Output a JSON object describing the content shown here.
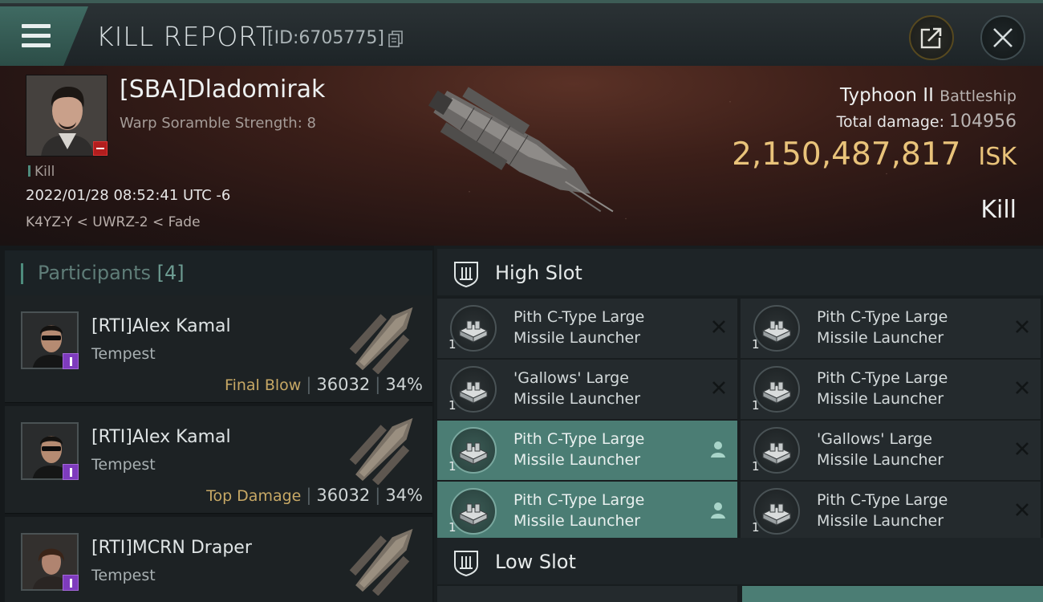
{
  "header": {
    "title": "KILL REPORT",
    "report_id": "[ID:6705775]"
  },
  "victim": {
    "name": "[SBA]Dladomirak",
    "attribute": "Warp Soramble Strength: 8",
    "tag": "Kill",
    "time": "2022/01/28 08:52:41 UTC -6",
    "location": "K4YZ-Y < UWRZ-2 < Fade",
    "ship": "Typhoon II",
    "ship_class": "Battleship",
    "total_damage_label": "Total damage:",
    "total_damage": "104956",
    "isk_value": "2,150,487,817",
    "isk_unit": "ISK",
    "result": "Kill"
  },
  "participants": {
    "title": "Participants",
    "count": "[4]",
    "rows": [
      {
        "name": "[RTI]Alex Kamal",
        "ship": "Tempest",
        "label": "Final Blow",
        "damage": "36032",
        "percent": "34%"
      },
      {
        "name": "[RTI]Alex Kamal",
        "ship": "Tempest",
        "label": "Top Damage",
        "damage": "36032",
        "percent": "34%"
      },
      {
        "name": "[RTI]MCRN Draper",
        "ship": "Tempest",
        "label": "",
        "damage": "",
        "percent": ""
      }
    ]
  },
  "high_slot": {
    "label": "High Slot",
    "modules": [
      {
        "line1": "Pith C-Type Large",
        "line2": "Missile Launcher",
        "qty": "1",
        "state": "destroyed"
      },
      {
        "line1": "Pith C-Type Large",
        "line2": "Missile Launcher",
        "qty": "1",
        "state": "destroyed"
      },
      {
        "line1": "'Gallows' Large",
        "line2": "Missile Launcher",
        "qty": "1",
        "state": "destroyed"
      },
      {
        "line1": "Pith C-Type Large",
        "line2": "Missile Launcher",
        "qty": "1",
        "state": "destroyed"
      },
      {
        "line1": "Pith C-Type Large",
        "line2": "Missile Launcher",
        "qty": "1",
        "state": "dropped"
      },
      {
        "line1": "'Gallows' Large",
        "line2": "Missile Launcher",
        "qty": "1",
        "state": "destroyed"
      },
      {
        "line1": "Pith C-Type Large",
        "line2": "Missile Launcher",
        "qty": "1",
        "state": "dropped"
      },
      {
        "line1": "Pith C-Type Large",
        "line2": "Missile Launcher",
        "qty": "1",
        "state": "destroyed"
      }
    ]
  },
  "low_slot": {
    "label": "Low Slot"
  },
  "colors": {
    "accent": "#4e8c7d",
    "isk": "#e9c37a",
    "dropped_bg": "#4b7d74",
    "badge_purple": "#7e3bbd",
    "label_gold": "#c7a865"
  }
}
